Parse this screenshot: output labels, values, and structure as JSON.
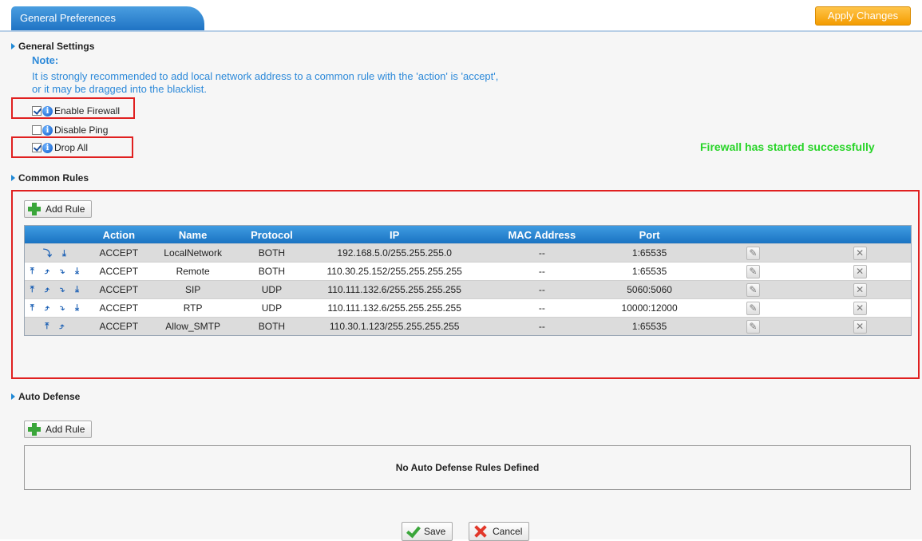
{
  "header": {
    "tab_title": "General Preferences",
    "apply_label": "Apply Changes"
  },
  "general": {
    "section_title": "General Settings",
    "note_title": "Note:",
    "note_line1": "It is strongly recommended to add local network address to a common rule with the 'action' is 'accept',",
    "note_line2": "or it may be dragged into the blacklist.",
    "options": [
      {
        "label": "Enable Firewall",
        "checked": true
      },
      {
        "label": "Disable Ping",
        "checked": false
      },
      {
        "label": "Drop All",
        "checked": true
      }
    ],
    "status_message": "Firewall has started successfully",
    "status_color": "#28d428"
  },
  "common_rules": {
    "section_title": "Common Rules",
    "add_label": "Add Rule",
    "columns": [
      "Action",
      "Name",
      "Protocol",
      "IP",
      "MAC Address",
      "Port"
    ],
    "rows": [
      {
        "moves": "⤵ ⤓",
        "action": "ACCEPT",
        "name": "LocalNetwork",
        "protocol": "BOTH",
        "ip": "192.168.5.0/255.255.255.0",
        "mac": "--",
        "port": "1:65535"
      },
      {
        "moves": "⤒ ⤴ ⤵ ⤓",
        "action": "ACCEPT",
        "name": "Remote",
        "protocol": "BOTH",
        "ip": "110.30.25.152/255.255.255.255",
        "mac": "--",
        "port": "1:65535"
      },
      {
        "moves": "⤒ ⤴ ⤵ ⤓",
        "action": "ACCEPT",
        "name": "SIP",
        "protocol": "UDP",
        "ip": "110.111.132.6/255.255.255.255",
        "mac": "--",
        "port": "5060:5060"
      },
      {
        "moves": "⤒ ⤴ ⤵ ⤓",
        "action": "ACCEPT",
        "name": "RTP",
        "protocol": "UDP",
        "ip": "110.111.132.6/255.255.255.255",
        "mac": "--",
        "port": "10000:12000"
      },
      {
        "moves": "⤒ ⤴",
        "action": "ACCEPT",
        "name": "Allow_SMTP",
        "protocol": "BOTH",
        "ip": "110.30.1.123/255.255.255.255",
        "mac": "--",
        "port": "1:65535"
      }
    ]
  },
  "auto_defense": {
    "section_title": "Auto Defense",
    "add_label": "Add Rule",
    "empty_message": "No Auto Defense Rules Defined"
  },
  "footer": {
    "save_label": "Save",
    "cancel_label": "Cancel"
  },
  "colors": {
    "accent": "#1f73c4",
    "apply_button": "#f49c00",
    "highlight_box": "#e02020"
  }
}
